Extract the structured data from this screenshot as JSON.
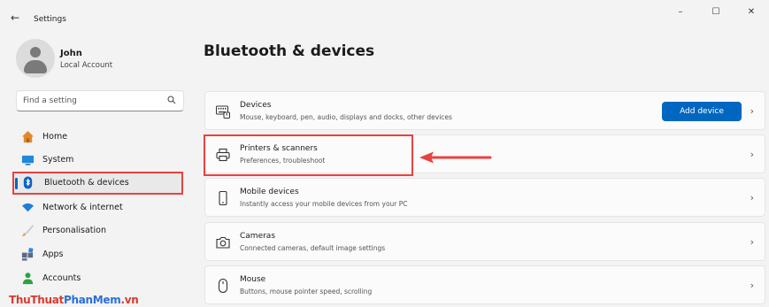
{
  "window": {
    "back_glyph": "←",
    "title": "Settings",
    "controls": [
      "–",
      "☐",
      "✕"
    ]
  },
  "profile": {
    "name": "John",
    "account": "Local Account"
  },
  "search": {
    "placeholder": "Find a setting",
    "icon": "search-icon"
  },
  "sidebar": {
    "items": [
      {
        "label": "Home",
        "icon": "home-icon"
      },
      {
        "label": "System",
        "icon": "system-icon"
      },
      {
        "label": "Bluetooth & devices",
        "icon": "bluetooth-icon",
        "active": true
      },
      {
        "label": "Network & internet",
        "icon": "wifi-icon"
      },
      {
        "label": "Personalisation",
        "icon": "brush-icon"
      },
      {
        "label": "Apps",
        "icon": "apps-icon"
      },
      {
        "label": "Accounts",
        "icon": "account-icon"
      }
    ]
  },
  "watermark": {
    "part1": "ThuThuat",
    "part2": "PhanMem",
    "part3": ".vn"
  },
  "main": {
    "title": "Bluetooth & devices",
    "cards": [
      {
        "title": "Devices",
        "desc": "Mouse, keyboard, pen, audio, displays and docks, other devices",
        "icon": "keyboard-icon",
        "button": "Add device"
      },
      {
        "title": "Printers & scanners",
        "desc": "Preferences, troubleshoot",
        "icon": "printer-icon"
      },
      {
        "title": "Mobile devices",
        "desc": "Instantly access your mobile devices from your PC",
        "icon": "phone-icon"
      },
      {
        "title": "Cameras",
        "desc": "Connected cameras, default image settings",
        "icon": "camera-icon"
      },
      {
        "title": "Mouse",
        "desc": "Buttons, mouse pointer speed, scrolling",
        "icon": "mouse-icon"
      }
    ],
    "chevron": "›"
  },
  "colors": {
    "accent": "#0067c0",
    "highlight": "#e8423f",
    "background": "#f3f3f3",
    "card": "#fbfbfb"
  }
}
